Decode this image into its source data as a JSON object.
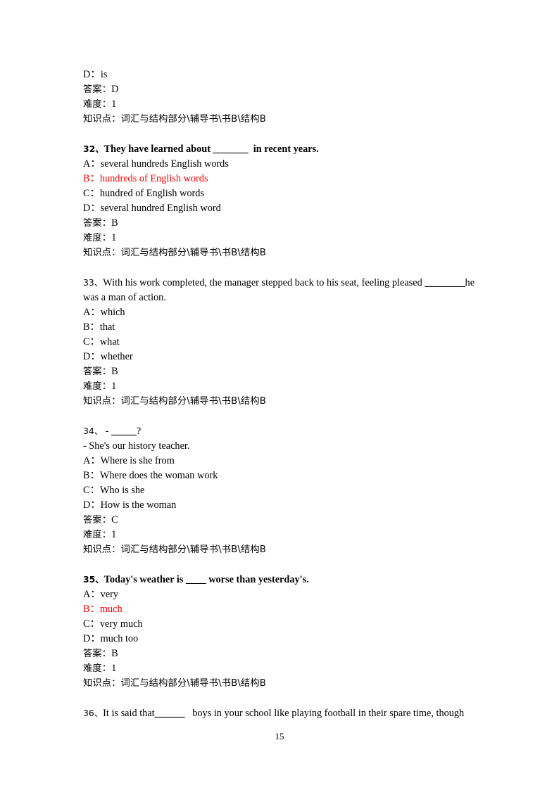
{
  "document": {
    "page_number": "15",
    "accent_color": "#ff0000",
    "text_color": "#000000",
    "background_color": "#ffffff"
  },
  "labels": {
    "answer": "答案：",
    "difficulty": "难度：",
    "knowledge_point": "知识点：",
    "knowledge_value": "词汇与结构部分\\辅导书\\书B\\结构B"
  },
  "top_fragment": {
    "option": "D：is",
    "answer": "D",
    "difficulty": "1",
    "knowledge": "词汇与结构部分\\辅导书\\书B\\结构B"
  },
  "questions": [
    {
      "number": "32、",
      "bold": true,
      "stem_before": "They have learned about ",
      "blank": "_______",
      "stem_after": "  in recent years.",
      "options": [
        {
          "label": "A：",
          "text": "several hundreds English words",
          "highlight": false
        },
        {
          "label": "B：",
          "text": "hundreds of English words",
          "highlight": true
        },
        {
          "label": "C：",
          "text": "hundred of English words",
          "highlight": false
        },
        {
          "label": "D：",
          "text": "several hundred English word",
          "highlight": false
        }
      ],
      "answer": "B",
      "difficulty": "1",
      "knowledge": "词汇与结构部分\\辅导书\\书B\\结构B"
    },
    {
      "number": "33、",
      "bold": false,
      "stem_before": "With his work completed, the manager stepped back to his seat, feeling pleased ",
      "blank": "________",
      "stem_after": "he",
      "stem_line2": "was a man of action.",
      "options": [
        {
          "label": "A：",
          "text": "which",
          "highlight": false
        },
        {
          "label": "B：",
          "text": "that",
          "highlight": false
        },
        {
          "label": "C：",
          "text": "what",
          "highlight": false
        },
        {
          "label": "D：",
          "text": "whether",
          "highlight": false
        }
      ],
      "answer": "B",
      "difficulty": "1",
      "knowledge": "词汇与结构部分\\辅导书\\书B\\结构B"
    },
    {
      "number": "34、",
      "bold": false,
      "stem_before": " - ",
      "blank": "_____",
      "stem_after": "?",
      "stem_line2": "- She's our history teacher.",
      "options": [
        {
          "label": "A：",
          "text": "Where is she from",
          "highlight": false
        },
        {
          "label": "B：",
          "text": "Where does the woman work",
          "highlight": false
        },
        {
          "label": "C：",
          "text": "Who is she",
          "highlight": false
        },
        {
          "label": "D：",
          "text": "How is the woman",
          "highlight": false
        }
      ],
      "answer": "C",
      "difficulty": "1",
      "knowledge": "词汇与结构部分\\辅导书\\书B\\结构B"
    },
    {
      "number": "35、",
      "bold": true,
      "stem_before": "Today's weather is ",
      "blank": "____",
      "stem_after": " worse than yesterday's.",
      "options": [
        {
          "label": "A：",
          "text": "very",
          "highlight": false
        },
        {
          "label": "B：",
          "text": "much",
          "highlight": true
        },
        {
          "label": "C：",
          "text": "very much",
          "highlight": false
        },
        {
          "label": "D：",
          "text": "much too",
          "highlight": false
        }
      ],
      "answer": "B",
      "difficulty": "1",
      "knowledge": "词汇与结构部分\\辅导书\\书B\\结构B"
    }
  ],
  "bottom_fragment": {
    "number": "36、",
    "stem_before": "It is said that",
    "blank": "______",
    "stem_after": "   boys in your school like playing football in their spare time, though"
  }
}
